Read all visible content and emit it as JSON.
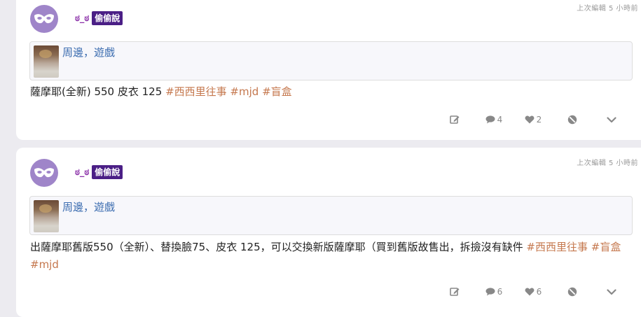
{
  "posts": [
    {
      "author": "ಠ_ಠ",
      "badge": "偷偷說",
      "edited": "上次編輯 5 小時前",
      "link_title": "周邊，遊戲",
      "content_text": "薩摩耶(全新) 550 皮衣 125",
      "tags": [
        "#西西里往事",
        "#mjd",
        "#盲盒"
      ],
      "comments": "4",
      "likes": "2"
    },
    {
      "author": "ಠ_ಠ",
      "badge": "偷偷說",
      "edited": "上次編輯 5 小時前",
      "link_title": "周邊，遊戲",
      "content_text": "出薩摩耶舊版550（全新）、替換臉75、皮衣 125，可以交換新版薩摩耶（買到舊版故售出，拆撿沒有缺件",
      "tags": [
        "#西西里往事",
        "#盲盒",
        "#mjd"
      ],
      "comments": "6",
      "likes": "6"
    }
  ],
  "icons": {
    "avatar": "mask-icon",
    "edit": "edit-icon",
    "comment": "comment-icon",
    "like": "heart-icon",
    "block": "block-icon",
    "expand": "chevron-down-icon"
  },
  "colors": {
    "avatar_bg": "#9f85c9",
    "author": "#8a2fa8",
    "badge_bg": "#4b1f86",
    "tag": "#c5784e",
    "link": "#3c6db0"
  }
}
